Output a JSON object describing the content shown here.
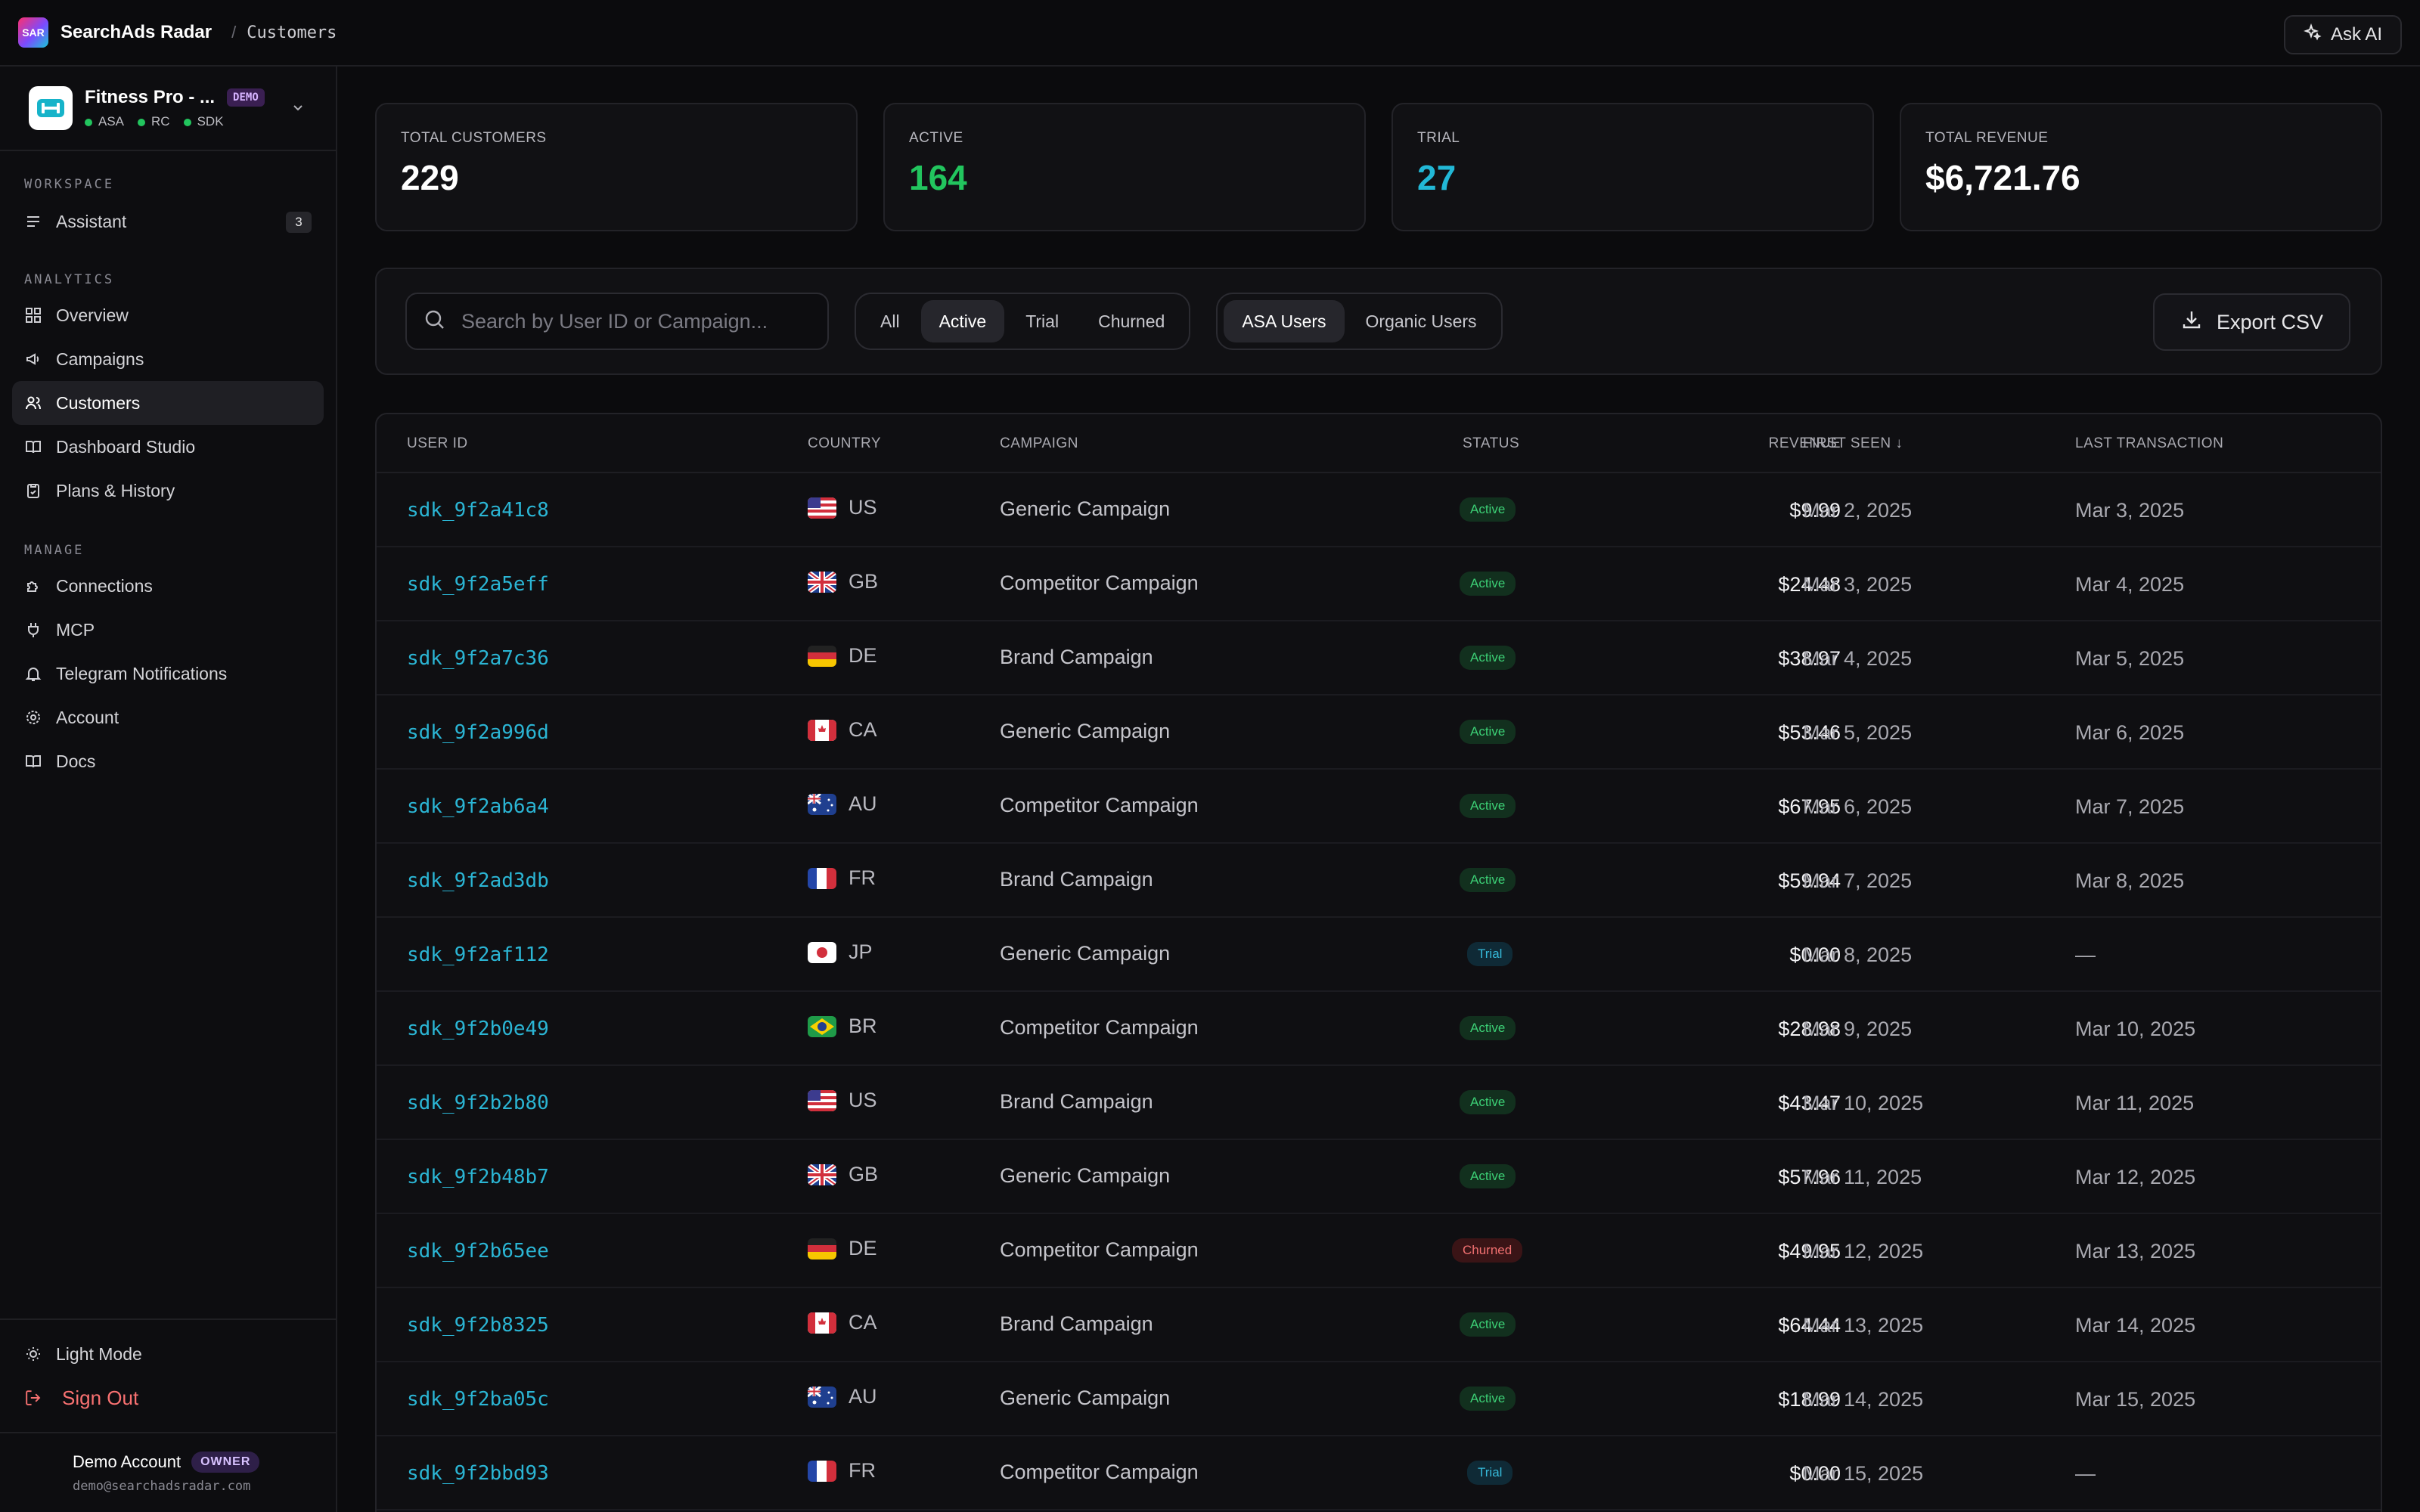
{
  "topbar": {
    "brand": "SearchAds Radar",
    "logo_text": "SAR",
    "crumb_sep": "/",
    "crumb": "Customers",
    "ask_ai": "Ask AI"
  },
  "app_switcher": {
    "name": "Fitness Pro - ...",
    "badge": "DEMO",
    "tags": [
      "ASA",
      "RC",
      "SDK"
    ]
  },
  "sidebar": {
    "workspace_label": "WORKSPACE",
    "assistant": {
      "label": "Assistant",
      "count": "3"
    },
    "analytics_label": "ANALYTICS",
    "analytics_items": [
      {
        "label": "Overview",
        "icon": "grid-icon"
      },
      {
        "label": "Campaigns",
        "icon": "megaphone-icon"
      },
      {
        "label": "Customers",
        "icon": "users-icon"
      },
      {
        "label": "Dashboard Studio",
        "icon": "book-open-icon"
      },
      {
        "label": "Plans & History",
        "icon": "clipboard-icon"
      }
    ],
    "manage_label": "MANAGE",
    "manage_items": [
      {
        "label": "Connections",
        "icon": "puzzle-icon"
      },
      {
        "label": "MCP",
        "icon": "plug-icon"
      },
      {
        "label": "Telegram Notifications",
        "icon": "bell-icon"
      },
      {
        "label": "Account",
        "icon": "gear-icon"
      },
      {
        "label": "Docs",
        "icon": "book-icon"
      }
    ],
    "light_mode": "Light Mode",
    "sign_out": "Sign Out",
    "user": {
      "name": "Demo Account",
      "role": "OWNER",
      "email": "demo@searchadsradar.com"
    }
  },
  "stats": [
    {
      "label": "TOTAL CUSTOMERS",
      "value": "229"
    },
    {
      "label": "ACTIVE",
      "value": "164"
    },
    {
      "label": "TRIAL",
      "value": "27"
    },
    {
      "label": "TOTAL REVENUE",
      "value": "$6,721.76"
    }
  ],
  "filters": {
    "search_placeholder": "Search by User ID or Campaign...",
    "status_tabs": [
      "All",
      "Active",
      "Trial",
      "Churned"
    ],
    "status_selected": "Active",
    "source_tabs": [
      "ASA Users",
      "Organic Users"
    ],
    "source_selected": "ASA Users",
    "export": "Export CSV"
  },
  "table": {
    "columns": [
      "USER ID",
      "COUNTRY",
      "CAMPAIGN",
      "STATUS",
      "REVENUE",
      "FIRST SEEN ↓",
      "LAST TRANSACTION"
    ],
    "rows": [
      {
        "user_id": "sdk_9f2a41c8",
        "country": "US",
        "campaign": "Generic Campaign",
        "status": "Active",
        "revenue": "$9.99",
        "first_seen": "Mar 2, 2025",
        "last_tx": "Mar 3, 2025"
      },
      {
        "user_id": "sdk_9f2a5eff",
        "country": "GB",
        "campaign": "Competitor Campaign",
        "status": "Active",
        "revenue": "$24.48",
        "first_seen": "Mar 3, 2025",
        "last_tx": "Mar 4, 2025"
      },
      {
        "user_id": "sdk_9f2a7c36",
        "country": "DE",
        "campaign": "Brand Campaign",
        "status": "Active",
        "revenue": "$38.97",
        "first_seen": "Mar 4, 2025",
        "last_tx": "Mar 5, 2025"
      },
      {
        "user_id": "sdk_9f2a996d",
        "country": "CA",
        "campaign": "Generic Campaign",
        "status": "Active",
        "revenue": "$53.46",
        "first_seen": "Mar 5, 2025",
        "last_tx": "Mar 6, 2025"
      },
      {
        "user_id": "sdk_9f2ab6a4",
        "country": "AU",
        "campaign": "Competitor Campaign",
        "status": "Active",
        "revenue": "$67.95",
        "first_seen": "Mar 6, 2025",
        "last_tx": "Mar 7, 2025"
      },
      {
        "user_id": "sdk_9f2ad3db",
        "country": "FR",
        "campaign": "Brand Campaign",
        "status": "Active",
        "revenue": "$59.94",
        "first_seen": "Mar 7, 2025",
        "last_tx": "Mar 8, 2025"
      },
      {
        "user_id": "sdk_9f2af112",
        "country": "JP",
        "campaign": "Generic Campaign",
        "status": "Trial",
        "revenue": "$0.00",
        "first_seen": "Mar 8, 2025",
        "last_tx": "—"
      },
      {
        "user_id": "sdk_9f2b0e49",
        "country": "BR",
        "campaign": "Competitor Campaign",
        "status": "Active",
        "revenue": "$28.98",
        "first_seen": "Mar 9, 2025",
        "last_tx": "Mar 10, 2025"
      },
      {
        "user_id": "sdk_9f2b2b80",
        "country": "US",
        "campaign": "Brand Campaign",
        "status": "Active",
        "revenue": "$43.47",
        "first_seen": "Mar 10, 2025",
        "last_tx": "Mar 11, 2025"
      },
      {
        "user_id": "sdk_9f2b48b7",
        "country": "GB",
        "campaign": "Generic Campaign",
        "status": "Active",
        "revenue": "$57.96",
        "first_seen": "Mar 11, 2025",
        "last_tx": "Mar 12, 2025"
      },
      {
        "user_id": "sdk_9f2b65ee",
        "country": "DE",
        "campaign": "Competitor Campaign",
        "status": "Churned",
        "revenue": "$49.95",
        "first_seen": "Mar 12, 2025",
        "last_tx": "Mar 13, 2025"
      },
      {
        "user_id": "sdk_9f2b8325",
        "country": "CA",
        "campaign": "Brand Campaign",
        "status": "Active",
        "revenue": "$64.44",
        "first_seen": "Mar 13, 2025",
        "last_tx": "Mar 14, 2025"
      },
      {
        "user_id": "sdk_9f2ba05c",
        "country": "AU",
        "campaign": "Generic Campaign",
        "status": "Active",
        "revenue": "$18.99",
        "first_seen": "Mar 14, 2025",
        "last_tx": "Mar 15, 2025"
      },
      {
        "user_id": "sdk_9f2bbd93",
        "country": "FR",
        "campaign": "Competitor Campaign",
        "status": "Trial",
        "revenue": "$0.00",
        "first_seen": "Mar 15, 2025",
        "last_tx": "—"
      }
    ]
  },
  "colors": {
    "active": "#22c55e",
    "trial": "#22b8d6",
    "churned": "#f07070",
    "link": "#2bb5d4"
  }
}
